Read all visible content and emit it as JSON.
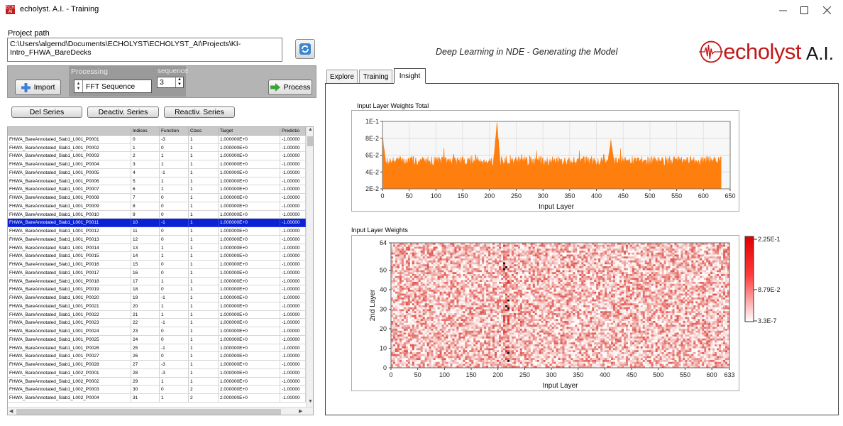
{
  "window": {
    "title": "echolyst. A.I. - Training",
    "icon_text": "ECH AI",
    "controls": [
      "minimize-icon",
      "maximize-icon",
      "close-icon"
    ]
  },
  "project": {
    "label": "Project path",
    "path_line1": "C:\\Users\\algernd\\Documents\\ECHOLYST\\ECHOLYST_AI\\Projects\\KI-",
    "path_line2": "Intro_FHWA_BareDecks"
  },
  "toolbar": {
    "import_label": "Import",
    "processing_label": "Processing",
    "sequence_label": "sequence",
    "processing_value": "FFT Sequence",
    "sequence_value": "3",
    "process_label": "Process"
  },
  "series_buttons": {
    "del": "Del Series",
    "deactiv": "Deactiv. Series",
    "reactiv": "Reactiv. Series"
  },
  "table": {
    "columns": [
      "",
      "Indices",
      "Function",
      "Class",
      "Target",
      "Predictio"
    ],
    "selected_index": 10,
    "rows": [
      [
        "FHWA_BareAnnotated_Slab1_L001_P0001",
        "0",
        "-3",
        "1",
        "1.000000E+0",
        "-1.00000"
      ],
      [
        "FHWA_BareAnnotated_Slab1_L001_P0002",
        "1",
        "0",
        "1",
        "1.000000E+0",
        "-1.00000"
      ],
      [
        "FHWA_BareAnnotated_Slab1_L001_P0003",
        "2",
        "1",
        "1",
        "1.000000E+0",
        "-1.00000"
      ],
      [
        "FHWA_BareAnnotated_Slab1_L001_P0004",
        "3",
        "1",
        "1",
        "1.000000E+0",
        "-1.00000"
      ],
      [
        "FHWA_BareAnnotated_Slab1_L001_P0005",
        "4",
        "-1",
        "1",
        "1.000000E+0",
        "-1.00000"
      ],
      [
        "FHWA_BareAnnotated_Slab1_L001_P0006",
        "5",
        "1",
        "1",
        "1.000000E+0",
        "-1.00000"
      ],
      [
        "FHWA_BareAnnotated_Slab1_L001_P0007",
        "6",
        "1",
        "1",
        "1.000000E+0",
        "-1.00000"
      ],
      [
        "FHWA_BareAnnotated_Slab1_L001_P0008",
        "7",
        "0",
        "1",
        "1.000000E+0",
        "-1.00000"
      ],
      [
        "FHWA_BareAnnotated_Slab1_L001_P0009",
        "8",
        "0",
        "1",
        "1.000000E+0",
        "-1.00000"
      ],
      [
        "FHWA_BareAnnotated_Slab1_L001_P0010",
        "9",
        "0",
        "1",
        "1.000000E+0",
        "-1.00000"
      ],
      [
        "FHWA_BareAnnotated_Slab1_L001_P0011",
        "10",
        "-1",
        "1",
        "1.000000E+0",
        "-1.00000"
      ],
      [
        "FHWA_BareAnnotated_Slab1_L001_P0012",
        "11",
        "0",
        "1",
        "1.000000E+0",
        "-1.00000"
      ],
      [
        "FHWA_BareAnnotated_Slab1_L001_P0013",
        "12",
        "0",
        "1",
        "1.000000E+0",
        "-1.00000"
      ],
      [
        "FHWA_BareAnnotated_Slab1_L001_P0014",
        "13",
        "1",
        "1",
        "1.000000E+0",
        "-1.00000"
      ],
      [
        "FHWA_BareAnnotated_Slab1_L001_P0015",
        "14",
        "1",
        "1",
        "1.000000E+0",
        "-1.00000"
      ],
      [
        "FHWA_BareAnnotated_Slab1_L001_P0016",
        "15",
        "0",
        "1",
        "1.000000E+0",
        "-1.00000"
      ],
      [
        "FHWA_BareAnnotated_Slab1_L001_P0017",
        "16",
        "0",
        "1",
        "1.000000E+0",
        "-1.00000"
      ],
      [
        "FHWA_BareAnnotated_Slab1_L001_P0018",
        "17",
        "1",
        "1",
        "1.000000E+0",
        "-1.00000"
      ],
      [
        "FHWA_BareAnnotated_Slab1_L001_P0019",
        "18",
        "0",
        "1",
        "1.000000E+0",
        "-1.00000"
      ],
      [
        "FHWA_BareAnnotated_Slab1_L001_P0020",
        "19",
        "-1",
        "1",
        "1.000000E+0",
        "-1.00000"
      ],
      [
        "FHWA_BareAnnotated_Slab1_L001_P0021",
        "20",
        "1",
        "1",
        "1.000000E+0",
        "-1.00000"
      ],
      [
        "FHWA_BareAnnotated_Slab1_L001_P0022",
        "21",
        "1",
        "1",
        "1.000000E+0",
        "-1.00000"
      ],
      [
        "FHWA_BareAnnotated_Slab1_L001_P0023",
        "22",
        "-1",
        "1",
        "1.000000E+0",
        "-1.00000"
      ],
      [
        "FHWA_BareAnnotated_Slab1_L001_P0024",
        "23",
        "0",
        "1",
        "1.000000E+0",
        "-1.00000"
      ],
      [
        "FHWA_BareAnnotated_Slab1_L001_P0025",
        "24",
        "0",
        "1",
        "1.000000E+0",
        "-1.00000"
      ],
      [
        "FHWA_BareAnnotated_Slab1_L001_P0026",
        "25",
        "-1",
        "1",
        "1.000000E+0",
        "-1.00000"
      ],
      [
        "FHWA_BareAnnotated_Slab1_L001_P0027",
        "26",
        "0",
        "1",
        "1.000000E+0",
        "-1.00000"
      ],
      [
        "FHWA_BareAnnotated_Slab1_L001_P0028",
        "27",
        "-3",
        "1",
        "1.000000E+0",
        "-1.00000"
      ],
      [
        "FHWA_BareAnnotated_Slab1_L002_P0001",
        "28",
        "-3",
        "1",
        "1.000000E+0",
        "-1.00000"
      ],
      [
        "FHWA_BareAnnotated_Slab1_L002_P0002",
        "29",
        "1",
        "1",
        "1.000000E+0",
        "-1.00000"
      ],
      [
        "FHWA_BareAnnotated_Slab1_L002_P0003",
        "30",
        "0",
        "2",
        "2.000000E+0",
        "-1.00000"
      ],
      [
        "FHWA_BareAnnotated_Slab1_L002_P0004",
        "31",
        "1",
        "2",
        "2.000000E+0",
        "-1.00000"
      ]
    ]
  },
  "header": {
    "subtitle": "Deep Learning in NDE - Generating the Model",
    "brand_name": "echolyst",
    "brand_suffix": "A.I.",
    "brand_color": "#c01818"
  },
  "tabs": [
    {
      "label": "Explore",
      "active": false
    },
    {
      "label": "Training",
      "active": false
    },
    {
      "label": "Insight",
      "active": true
    }
  ],
  "chart_data": [
    {
      "type": "area",
      "title": "Input Layer Weights Total",
      "xlabel": "Input Layer",
      "ylabel": "",
      "xlim": [
        0,
        650
      ],
      "ylim": [
        0.02,
        0.1
      ],
      "xticks": [
        0,
        50,
        100,
        150,
        200,
        250,
        300,
        350,
        400,
        450,
        500,
        550,
        600,
        650
      ],
      "yticks": [
        "2E-2",
        "4E-2",
        "6E-2",
        "8E-2",
        "1E-1"
      ],
      "series_color": "#ff7f0e",
      "n_points": 634,
      "baseline_mean": 0.053,
      "peaks": [
        {
          "x": 0,
          "y": 0.082
        },
        {
          "x": 214,
          "y": 0.098
        },
        {
          "x": 427,
          "y": 0.077
        }
      ],
      "grid": true
    },
    {
      "type": "heatmap",
      "title": "Input Layer Weights",
      "xlabel": "Input Layer",
      "ylabel": "2nd Layer",
      "xlim": [
        0,
        633
      ],
      "ylim": [
        0,
        64
      ],
      "xticks": [
        "0",
        "50",
        "100",
        "150",
        "200",
        "250",
        "300",
        "350",
        "400",
        "450",
        "500",
        "550",
        "600",
        "633"
      ],
      "yticks": [
        "0",
        "10",
        "20",
        "30",
        "40",
        "50",
        "64"
      ],
      "colorscale": {
        "min": "3.3E-7",
        "mid": "8.79E-2",
        "max": "2.25E-1",
        "low_color": "#ffffff",
        "high_color": "#dd0000"
      }
    }
  ]
}
